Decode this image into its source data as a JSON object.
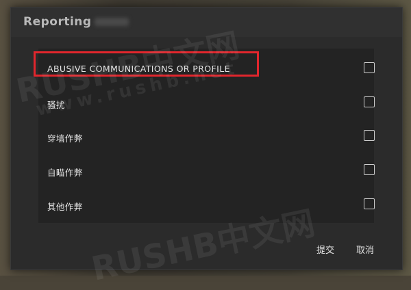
{
  "dialog": {
    "title": "Reporting",
    "options": [
      {
        "label": "ABUSIVE COMMUNICATIONS OR PROFILE",
        "checked": false
      },
      {
        "label": "骚扰",
        "checked": false
      },
      {
        "label": "穿墙作弊",
        "checked": false
      },
      {
        "label": "自瞄作弊",
        "checked": false
      },
      {
        "label": "其他作弊",
        "checked": false
      }
    ],
    "submit_label": "提交",
    "cancel_label": "取消"
  },
  "watermark": {
    "brand": "RUSHB中文网",
    "url": "www.rushb.net"
  },
  "colors": {
    "highlight": "#e2262d",
    "dialog_bg": "#2b2b2b",
    "panel_bg": "#232323"
  }
}
